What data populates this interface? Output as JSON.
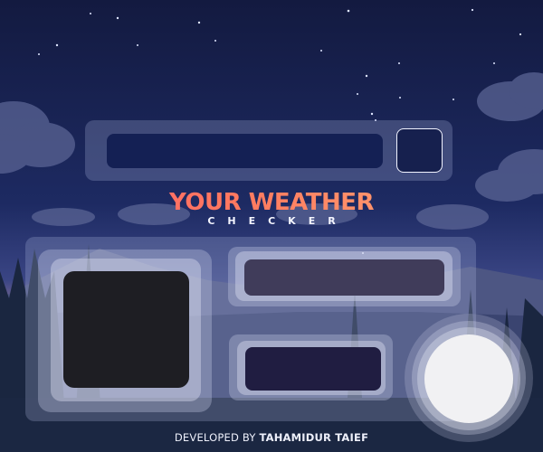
{
  "app": {
    "title_main": "YOUR WEATHER",
    "title_sub": "CHECKER"
  },
  "search": {
    "value": "",
    "placeholder": ""
  },
  "footer": {
    "prefix": "DEVELOPED BY",
    "author": "TAHAMIDUR TAIEF"
  },
  "weather": {
    "temperature": "",
    "description": ""
  },
  "icons": {
    "moon": "crescent-moon",
    "toggle": "theme-toggle-circle"
  },
  "colors": {
    "sky_top": "#141d48",
    "sky_mid": "#2d3b78",
    "horizon": "#c9808e",
    "mountains": "#4f5a86",
    "forest": "#1e2a45",
    "title_gradient_start": "#ff5b6e",
    "title_gradient_end": "#ffb27a",
    "input_bg": "#142054",
    "icon_box_bg": "#1e1e23",
    "temp_box_bg": "#403c5a",
    "desc_box_bg": "#201d41",
    "toggle_bg": "#f1f1f3"
  }
}
